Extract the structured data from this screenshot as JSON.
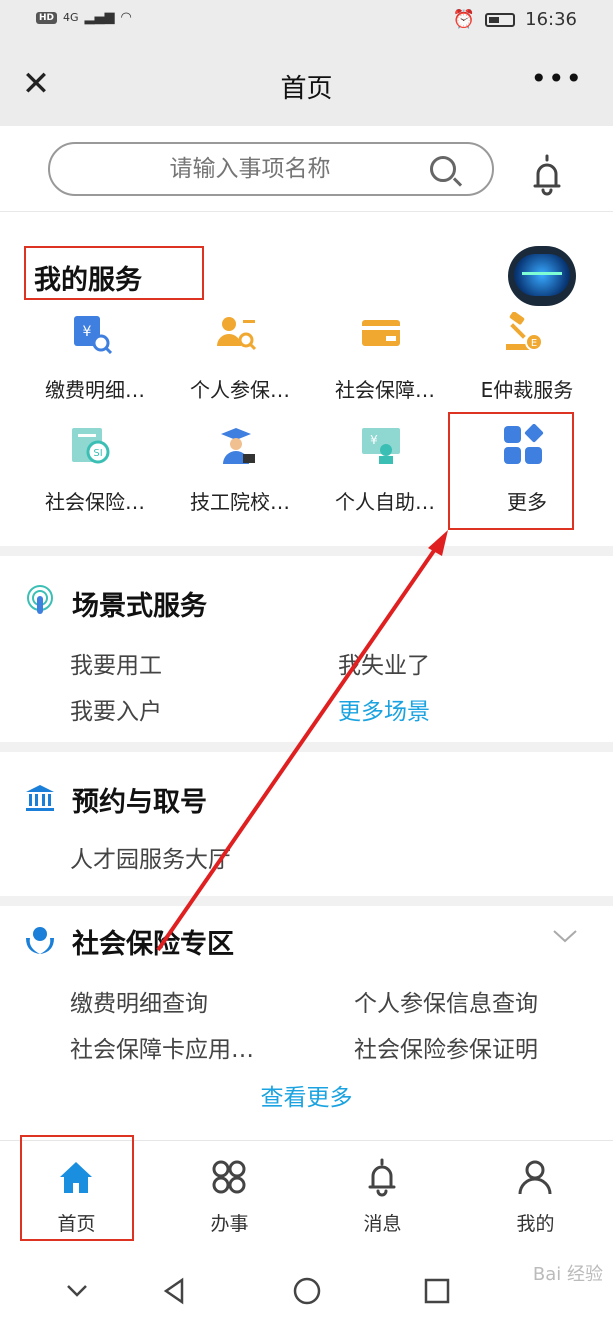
{
  "status_bar": {
    "network": "4G",
    "hd": "HD",
    "time": "16:36"
  },
  "header": {
    "title": "首页",
    "close_icon": "close-icon",
    "more_icon": "more-dots-icon"
  },
  "search": {
    "placeholder": "请输入事项名称"
  },
  "services": {
    "title": "我的服务",
    "items": [
      {
        "label": "缴费明细…",
        "icon": "payment-detail-icon",
        "color": "#3f7fe0"
      },
      {
        "label": "个人参保…",
        "icon": "person-insurance-icon",
        "color": "#f0a830"
      },
      {
        "label": "社会保障…",
        "icon": "social-card-icon",
        "color": "#f0a830"
      },
      {
        "label": "E仲裁服务",
        "icon": "arbitration-icon",
        "color": "#f0a830"
      },
      {
        "label": "社会保险…",
        "icon": "social-insurance-icon",
        "color": "#3bbfb5"
      },
      {
        "label": "技工院校…",
        "icon": "graduate-icon",
        "color": "#3f7fe0"
      },
      {
        "label": "个人自助…",
        "icon": "self-service-icon",
        "color": "#3bbfb5"
      },
      {
        "label": "更多",
        "icon": "grid-more-icon",
        "color": "#3f7fe0"
      }
    ]
  },
  "scene": {
    "title": "场景式服务",
    "links": [
      "我要用工",
      "我失业了",
      "我要入户",
      "更多场景"
    ]
  },
  "appointment": {
    "title": "预约与取号",
    "links": [
      "人才园服务大厅"
    ]
  },
  "social": {
    "title": "社会保险专区",
    "links": [
      "缴费明细查询",
      "个人参保信息查询",
      "社会保障卡应用…",
      "社会保险参保证明"
    ],
    "more": "查看更多"
  },
  "tabbar": {
    "tabs": [
      {
        "label": "首页",
        "icon": "home-icon"
      },
      {
        "label": "办事",
        "icon": "services-grid-icon"
      },
      {
        "label": "消息",
        "icon": "bell-icon"
      },
      {
        "label": "我的",
        "icon": "user-icon"
      }
    ]
  },
  "colors": {
    "accent": "#1aa3e0",
    "highlight_box": "#d32f2f",
    "arrow": "#e02020"
  },
  "watermark": "Bai 经验"
}
